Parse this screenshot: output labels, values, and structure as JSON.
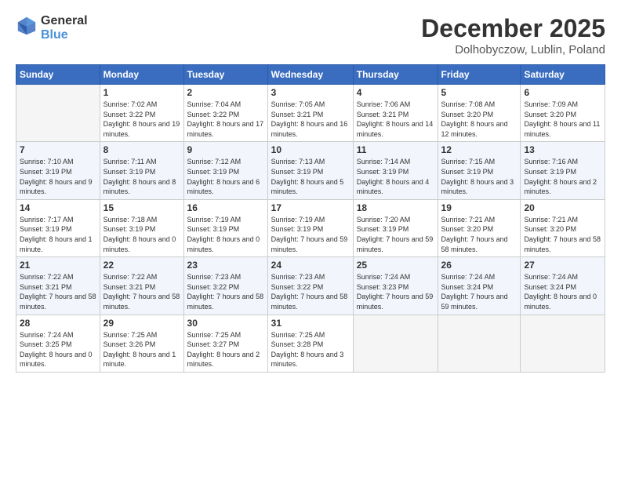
{
  "header": {
    "logo_general": "General",
    "logo_blue": "Blue",
    "month": "December 2025",
    "location": "Dolhobyczow, Lublin, Poland"
  },
  "days_of_week": [
    "Sunday",
    "Monday",
    "Tuesday",
    "Wednesday",
    "Thursday",
    "Friday",
    "Saturday"
  ],
  "weeks": [
    [
      {
        "day": "",
        "sunrise": "",
        "sunset": "",
        "daylight": "",
        "empty": true
      },
      {
        "day": "1",
        "sunrise": "Sunrise: 7:02 AM",
        "sunset": "Sunset: 3:22 PM",
        "daylight": "Daylight: 8 hours and 19 minutes."
      },
      {
        "day": "2",
        "sunrise": "Sunrise: 7:04 AM",
        "sunset": "Sunset: 3:22 PM",
        "daylight": "Daylight: 8 hours and 17 minutes."
      },
      {
        "day": "3",
        "sunrise": "Sunrise: 7:05 AM",
        "sunset": "Sunset: 3:21 PM",
        "daylight": "Daylight: 8 hours and 16 minutes."
      },
      {
        "day": "4",
        "sunrise": "Sunrise: 7:06 AM",
        "sunset": "Sunset: 3:21 PM",
        "daylight": "Daylight: 8 hours and 14 minutes."
      },
      {
        "day": "5",
        "sunrise": "Sunrise: 7:08 AM",
        "sunset": "Sunset: 3:20 PM",
        "daylight": "Daylight: 8 hours and 12 minutes."
      },
      {
        "day": "6",
        "sunrise": "Sunrise: 7:09 AM",
        "sunset": "Sunset: 3:20 PM",
        "daylight": "Daylight: 8 hours and 11 minutes."
      }
    ],
    [
      {
        "day": "7",
        "sunrise": "Sunrise: 7:10 AM",
        "sunset": "Sunset: 3:19 PM",
        "daylight": "Daylight: 8 hours and 9 minutes."
      },
      {
        "day": "8",
        "sunrise": "Sunrise: 7:11 AM",
        "sunset": "Sunset: 3:19 PM",
        "daylight": "Daylight: 8 hours and 8 minutes."
      },
      {
        "day": "9",
        "sunrise": "Sunrise: 7:12 AM",
        "sunset": "Sunset: 3:19 PM",
        "daylight": "Daylight: 8 hours and 6 minutes."
      },
      {
        "day": "10",
        "sunrise": "Sunrise: 7:13 AM",
        "sunset": "Sunset: 3:19 PM",
        "daylight": "Daylight: 8 hours and 5 minutes."
      },
      {
        "day": "11",
        "sunrise": "Sunrise: 7:14 AM",
        "sunset": "Sunset: 3:19 PM",
        "daylight": "Daylight: 8 hours and 4 minutes."
      },
      {
        "day": "12",
        "sunrise": "Sunrise: 7:15 AM",
        "sunset": "Sunset: 3:19 PM",
        "daylight": "Daylight: 8 hours and 3 minutes."
      },
      {
        "day": "13",
        "sunrise": "Sunrise: 7:16 AM",
        "sunset": "Sunset: 3:19 PM",
        "daylight": "Daylight: 8 hours and 2 minutes."
      }
    ],
    [
      {
        "day": "14",
        "sunrise": "Sunrise: 7:17 AM",
        "sunset": "Sunset: 3:19 PM",
        "daylight": "Daylight: 8 hours and 1 minute."
      },
      {
        "day": "15",
        "sunrise": "Sunrise: 7:18 AM",
        "sunset": "Sunset: 3:19 PM",
        "daylight": "Daylight: 8 hours and 0 minutes."
      },
      {
        "day": "16",
        "sunrise": "Sunrise: 7:19 AM",
        "sunset": "Sunset: 3:19 PM",
        "daylight": "Daylight: 8 hours and 0 minutes."
      },
      {
        "day": "17",
        "sunrise": "Sunrise: 7:19 AM",
        "sunset": "Sunset: 3:19 PM",
        "daylight": "Daylight: 7 hours and 59 minutes."
      },
      {
        "day": "18",
        "sunrise": "Sunrise: 7:20 AM",
        "sunset": "Sunset: 3:19 PM",
        "daylight": "Daylight: 7 hours and 59 minutes."
      },
      {
        "day": "19",
        "sunrise": "Sunrise: 7:21 AM",
        "sunset": "Sunset: 3:20 PM",
        "daylight": "Daylight: 7 hours and 58 minutes."
      },
      {
        "day": "20",
        "sunrise": "Sunrise: 7:21 AM",
        "sunset": "Sunset: 3:20 PM",
        "daylight": "Daylight: 7 hours and 58 minutes."
      }
    ],
    [
      {
        "day": "21",
        "sunrise": "Sunrise: 7:22 AM",
        "sunset": "Sunset: 3:21 PM",
        "daylight": "Daylight: 7 hours and 58 minutes."
      },
      {
        "day": "22",
        "sunrise": "Sunrise: 7:22 AM",
        "sunset": "Sunset: 3:21 PM",
        "daylight": "Daylight: 7 hours and 58 minutes."
      },
      {
        "day": "23",
        "sunrise": "Sunrise: 7:23 AM",
        "sunset": "Sunset: 3:22 PM",
        "daylight": "Daylight: 7 hours and 58 minutes."
      },
      {
        "day": "24",
        "sunrise": "Sunrise: 7:23 AM",
        "sunset": "Sunset: 3:22 PM",
        "daylight": "Daylight: 7 hours and 58 minutes."
      },
      {
        "day": "25",
        "sunrise": "Sunrise: 7:24 AM",
        "sunset": "Sunset: 3:23 PM",
        "daylight": "Daylight: 7 hours and 59 minutes."
      },
      {
        "day": "26",
        "sunrise": "Sunrise: 7:24 AM",
        "sunset": "Sunset: 3:24 PM",
        "daylight": "Daylight: 7 hours and 59 minutes."
      },
      {
        "day": "27",
        "sunrise": "Sunrise: 7:24 AM",
        "sunset": "Sunset: 3:24 PM",
        "daylight": "Daylight: 8 hours and 0 minutes."
      }
    ],
    [
      {
        "day": "28",
        "sunrise": "Sunrise: 7:24 AM",
        "sunset": "Sunset: 3:25 PM",
        "daylight": "Daylight: 8 hours and 0 minutes."
      },
      {
        "day": "29",
        "sunrise": "Sunrise: 7:25 AM",
        "sunset": "Sunset: 3:26 PM",
        "daylight": "Daylight: 8 hours and 1 minute."
      },
      {
        "day": "30",
        "sunrise": "Sunrise: 7:25 AM",
        "sunset": "Sunset: 3:27 PM",
        "daylight": "Daylight: 8 hours and 2 minutes."
      },
      {
        "day": "31",
        "sunrise": "Sunrise: 7:25 AM",
        "sunset": "Sunset: 3:28 PM",
        "daylight": "Daylight: 8 hours and 3 minutes."
      },
      {
        "day": "",
        "sunrise": "",
        "sunset": "",
        "daylight": "",
        "empty": true
      },
      {
        "day": "",
        "sunrise": "",
        "sunset": "",
        "daylight": "",
        "empty": true
      },
      {
        "day": "",
        "sunrise": "",
        "sunset": "",
        "daylight": "",
        "empty": true
      }
    ]
  ]
}
